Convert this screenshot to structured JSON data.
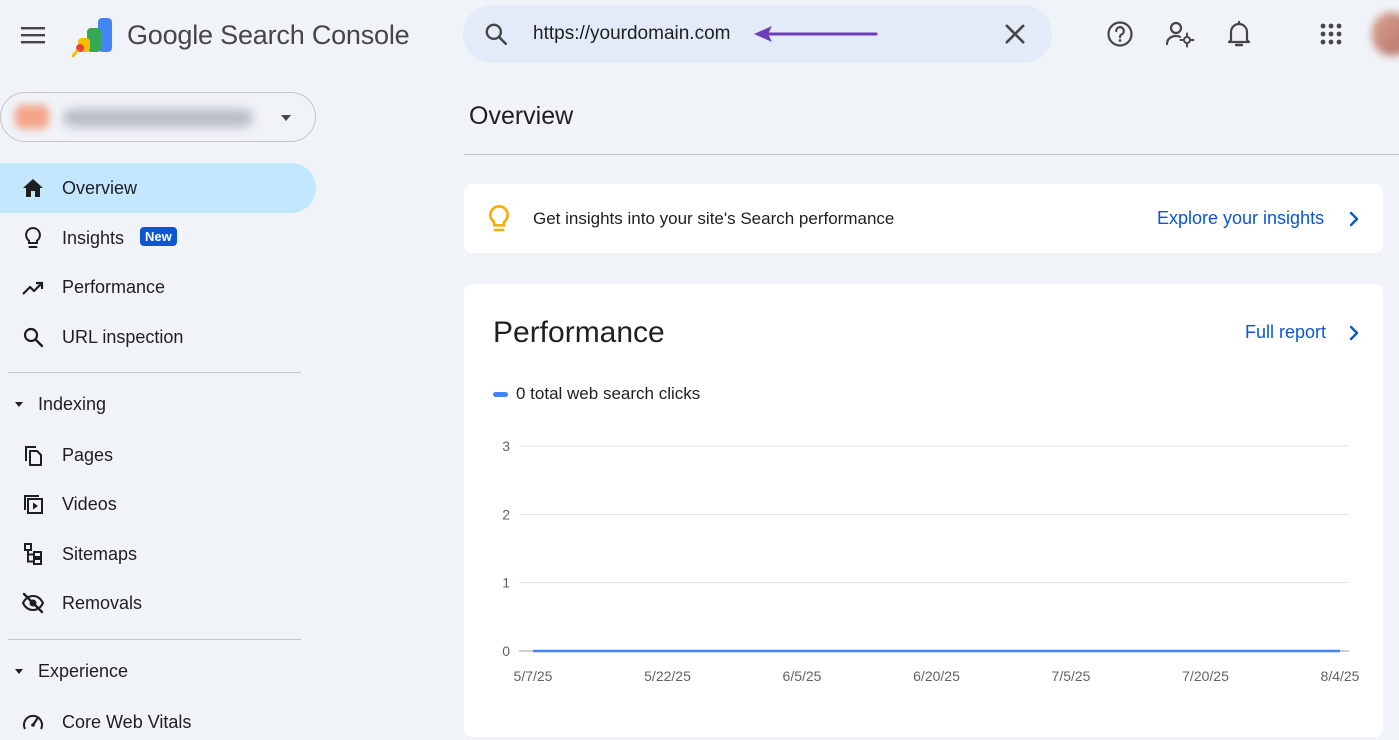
{
  "header": {
    "app_title": "Google Search Console",
    "search": {
      "value": "https://yourdomain.com"
    }
  },
  "sidebar": {
    "property": {
      "name_redacted": true
    },
    "items": [
      {
        "label": "Overview",
        "icon": "home-icon",
        "active": true
      },
      {
        "label": "Insights",
        "icon": "lightbulb-icon",
        "badge": "New"
      },
      {
        "label": "Performance",
        "icon": "trending-up-icon"
      },
      {
        "label": "URL inspection",
        "icon": "search-icon"
      }
    ],
    "sections": [
      {
        "label": "Indexing",
        "items": [
          {
            "label": "Pages",
            "icon": "pages-icon"
          },
          {
            "label": "Videos",
            "icon": "video-icon"
          },
          {
            "label": "Sitemaps",
            "icon": "sitemap-icon"
          },
          {
            "label": "Removals",
            "icon": "visibility-off-icon"
          }
        ]
      },
      {
        "label": "Experience",
        "items": [
          {
            "label": "Core Web Vitals",
            "icon": "speed-gauge-icon"
          }
        ]
      }
    ]
  },
  "main": {
    "title": "Overview",
    "insights_card": {
      "text": "Get insights into your site's Search performance",
      "link": "Explore your insights"
    },
    "performance_card": {
      "title": "Performance",
      "link": "Full report",
      "legend": "0 total web search clicks"
    }
  },
  "colors": {
    "accent": "#0b57d0",
    "active_nav": "#c2e7ff",
    "series": "#4285f4",
    "annotation_arrow": "#6b3fb8",
    "background": "#f0f3f8"
  },
  "chart_data": {
    "type": "line",
    "title": "",
    "xlabel": "",
    "ylabel": "",
    "x_ticks": [
      "5/7/25",
      "5/22/25",
      "6/5/25",
      "6/20/25",
      "7/5/25",
      "7/20/25",
      "8/4/25"
    ],
    "y_ticks": [
      0,
      1,
      2,
      3
    ],
    "ylim": [
      0,
      3
    ],
    "grid": true,
    "series": [
      {
        "name": "0 total web search clicks",
        "color": "#4285f4",
        "x": [
          "5/7/25",
          "5/22/25",
          "6/5/25",
          "6/20/25",
          "7/5/25",
          "7/20/25",
          "8/4/25"
        ],
        "values": [
          0,
          0,
          0,
          0,
          0,
          0,
          0
        ]
      }
    ]
  }
}
